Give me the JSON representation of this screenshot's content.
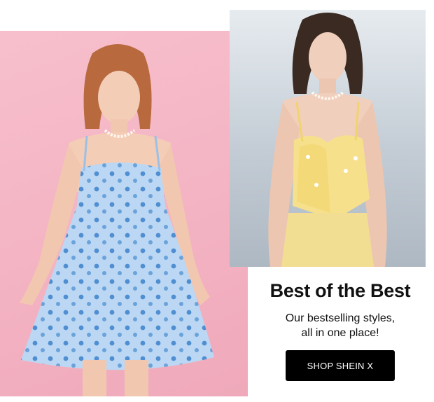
{
  "promo": {
    "headline": "Best of the Best",
    "subline_1": "Our bestselling styles,",
    "subline_2": "all in one place!",
    "cta_label": "SHOP SHEIN X"
  },
  "colors": {
    "left_background": "#f3b2c2",
    "right_background": "#c3ccd5",
    "button_bg": "#000000",
    "button_text": "#ffffff"
  }
}
